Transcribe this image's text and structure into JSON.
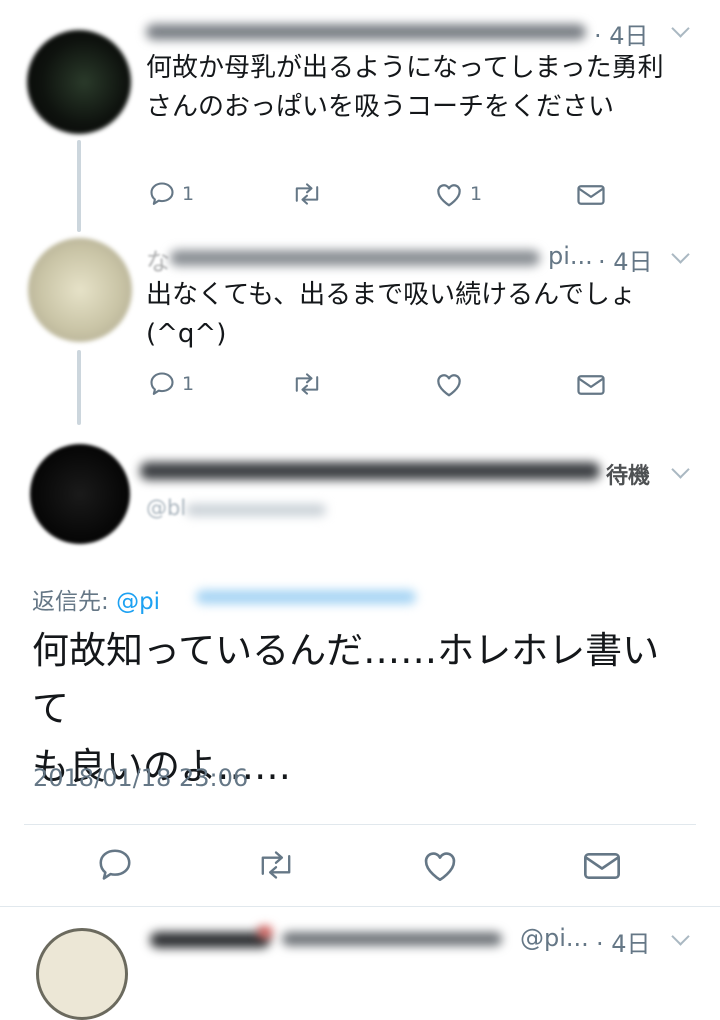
{
  "colors": {
    "accent": "#1da1f2",
    "text": "#14171a",
    "muted": "#657786",
    "line": "#ccd6dd"
  },
  "replies": [
    {
      "handle_partial": "",
      "time": "· 4日",
      "text": "何故か母乳が出るようになってしまった勇利さんのおっぱいを吸うコーチをください",
      "reply_count": "1",
      "retweet_count": "",
      "like_count": "1"
    },
    {
      "name_partial": "な",
      "handle_partial": "pi...",
      "time": "· 4日",
      "text": "出なくても、出るまで吸い続けるんでしょ(^q^)",
      "reply_count": "1",
      "retweet_count": "",
      "like_count": ""
    }
  ],
  "main_tweet": {
    "name_partial": "待機",
    "handle_partial": "@bl",
    "reply_to_label": "返信先:",
    "reply_to_handle": "@pi",
    "text_line1": "何故知っているんだ……ホレホレ書いて",
    "text_line2": "も良いのよ……",
    "timestamp": "2018/01/18 23:06"
  },
  "next_tweet": {
    "handle_partial": "@pi...",
    "time": "· 4日"
  },
  "icons": [
    "reply-icon",
    "retweet-icon",
    "like-icon",
    "message-icon",
    "chevron-down-icon"
  ]
}
